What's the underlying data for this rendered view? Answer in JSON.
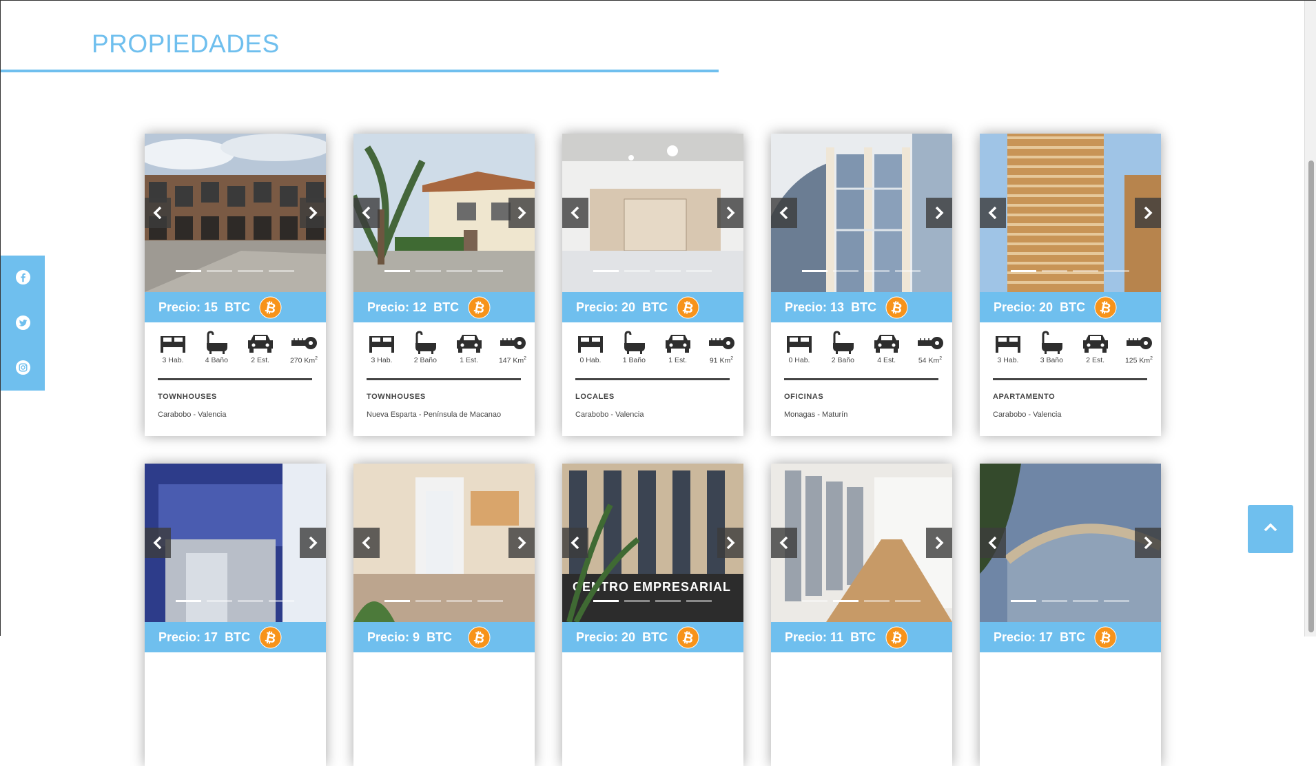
{
  "header": {
    "title": "PROPIEDADES"
  },
  "social": [
    "facebook-icon",
    "twitter-icon",
    "instagram-icon"
  ],
  "colors": {
    "accent": "#6fbfee",
    "bitcoin": "#f7931a",
    "text": "#444444"
  },
  "cards": [
    {
      "price": "15",
      "currency": "BTC",
      "rooms": "3 Hab.",
      "baths": "4 Baño",
      "parking": "2 Est.",
      "area": "270 Km",
      "type": "TOWNHOUSES",
      "location": "Carabobo - Valencia",
      "active_slide": 0,
      "scene": "townhouse"
    },
    {
      "price": "12",
      "currency": "BTC",
      "rooms": "3 Hab.",
      "baths": "2 Baño",
      "parking": "1 Est.",
      "area": "147 Km",
      "type": "TOWNHOUSES",
      "location": "Nueva Esparta - Península de Macanao",
      "active_slide": 0,
      "scene": "house"
    },
    {
      "price": "20",
      "currency": "BTC",
      "rooms": "0 Hab.",
      "baths": "1 Baño",
      "parking": "1 Est.",
      "area": "91 Km",
      "type": "LOCALES",
      "location": "Carabobo - Valencia",
      "active_slide": 0,
      "scene": "store"
    },
    {
      "price": "13",
      "currency": "BTC",
      "rooms": "0 Hab.",
      "baths": "2 Baño",
      "parking": "4 Est.",
      "area": "54 Km",
      "type": "OFICINAS",
      "location": "Monagas - Maturín",
      "active_slide": 0,
      "scene": "glass"
    },
    {
      "price": "20",
      "currency": "BTC",
      "rooms": "3 Hab.",
      "baths": "3 Baño",
      "parking": "2 Est.",
      "area": "125 Km",
      "type": "APARTAMENTO",
      "location": "Carabobo - Valencia",
      "active_slide": 0,
      "scene": "tower"
    },
    {
      "price": "17",
      "currency": "BTC",
      "rooms": "",
      "baths": "",
      "parking": "",
      "area": "",
      "type": "",
      "location": "",
      "active_slide": 0,
      "scene": "office"
    },
    {
      "price": "9",
      "currency": "BTC",
      "rooms": "",
      "baths": "",
      "parking": "",
      "area": "",
      "type": "",
      "location": "",
      "active_slide": 0,
      "scene": "patio"
    },
    {
      "price": "20",
      "currency": "BTC",
      "rooms": "",
      "baths": "",
      "parking": "",
      "area": "",
      "type": "",
      "location": "",
      "active_slide": 0,
      "scene": "centro",
      "sign": "CENTRO EMPRESARIAL"
    },
    {
      "price": "11",
      "currency": "BTC",
      "rooms": "",
      "baths": "",
      "parking": "",
      "area": "",
      "type": "",
      "location": "",
      "active_slide": 1,
      "scene": "storage"
    },
    {
      "price": "17",
      "currency": "BTC",
      "rooms": "",
      "baths": "",
      "parking": "",
      "area": "",
      "type": "",
      "location": "",
      "active_slide": 0,
      "scene": "curved"
    }
  ],
  "price_prefix": "Precio:",
  "area_superscript": "2",
  "slide_count": 4
}
